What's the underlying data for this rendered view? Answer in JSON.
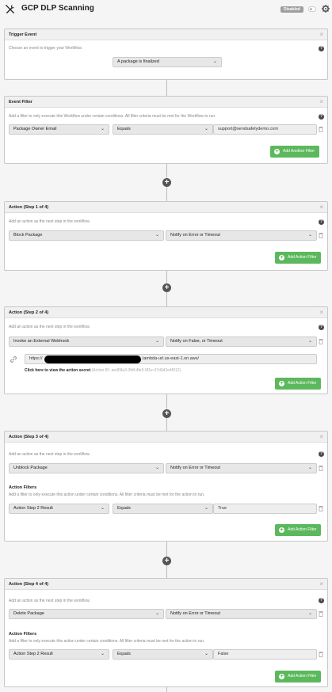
{
  "header": {
    "title": "GCP DLP Scanning",
    "status": "Disabled"
  },
  "trigger": {
    "title": "Trigger Event",
    "hint": "Choose an event to trigger your Workflow.",
    "event": "A package is finalized"
  },
  "filter": {
    "title": "Event Filter",
    "hint": "Add a filter to only execute this Workflow under certain conditions. All filter criteria must be met for the Workflow to run.",
    "field": "Package Owner Email",
    "op": "Equals",
    "value": "support@sendsafelydemo.com",
    "add_label": "Add Another Filter"
  },
  "steps": [
    {
      "title": "Action (Step 1 of 4)",
      "hint": "Add an action as the next step in the workflow.",
      "action": "Block Package",
      "notify": "Notify on Error or Timeout",
      "add_label": "Add Action Filter"
    },
    {
      "title": "Action (Step 2 of 4)",
      "hint": "Add an action as the next step in the workflow.",
      "action": "Invoke an External Webhook",
      "notify": "Notify on False, or Timeout",
      "url_prefix": "https://",
      "url_suffix": ".lambda-url.us-east-1.on.aws/",
      "secret_link": "Click here to view the action secret",
      "action_id": "(Action ID: aed58e3-3fdf-4fe5-9f1e-47d3d2e4f912)",
      "add_label": "Add Action Filter"
    },
    {
      "title": "Action (Step 3 of 4)",
      "hint": "Add an action as the next step in the workflow.",
      "action": "Unblock Package",
      "notify": "Notify on Error or Timeout",
      "filters_title": "Action Filters",
      "filters_hint": "Add a filter to only execute this action under certain conditions. All filter criteria must be met for the action to run.",
      "f_field": "Action Step 2 Result",
      "f_op": "Equals",
      "f_value": "True",
      "add_label": "Add Action Filter"
    },
    {
      "title": "Action (Step 4 of 4)",
      "hint": "Add an action as the next step in the workflow.",
      "action": "Delete Package",
      "notify": "Notify on Error or Timeout",
      "filters_title": "Action Filters",
      "filters_hint": "Add a filter to only execute this action under certain conditions. All filter criteria must be met for the action to run.",
      "f_field": "Action Step 2 Result",
      "f_op": "Equals",
      "f_value": "False",
      "add_label": "Add Action Filter"
    }
  ],
  "icons": {
    "logo": "tools-icon",
    "settings": "gear-icon",
    "close": "close-icon",
    "help": "help-icon",
    "trash": "trash-icon",
    "add": "plus-icon",
    "link": "link-icon",
    "chevron": "chevron-down-icon"
  },
  "glyphs": {
    "close": "×",
    "help": "?",
    "chevron": "⌄",
    "plus": "+",
    "add": "+"
  },
  "colors": {
    "accent": "#5cb85c",
    "disabled": "#9e9e9e",
    "header_bg": "#f0f0f0"
  }
}
